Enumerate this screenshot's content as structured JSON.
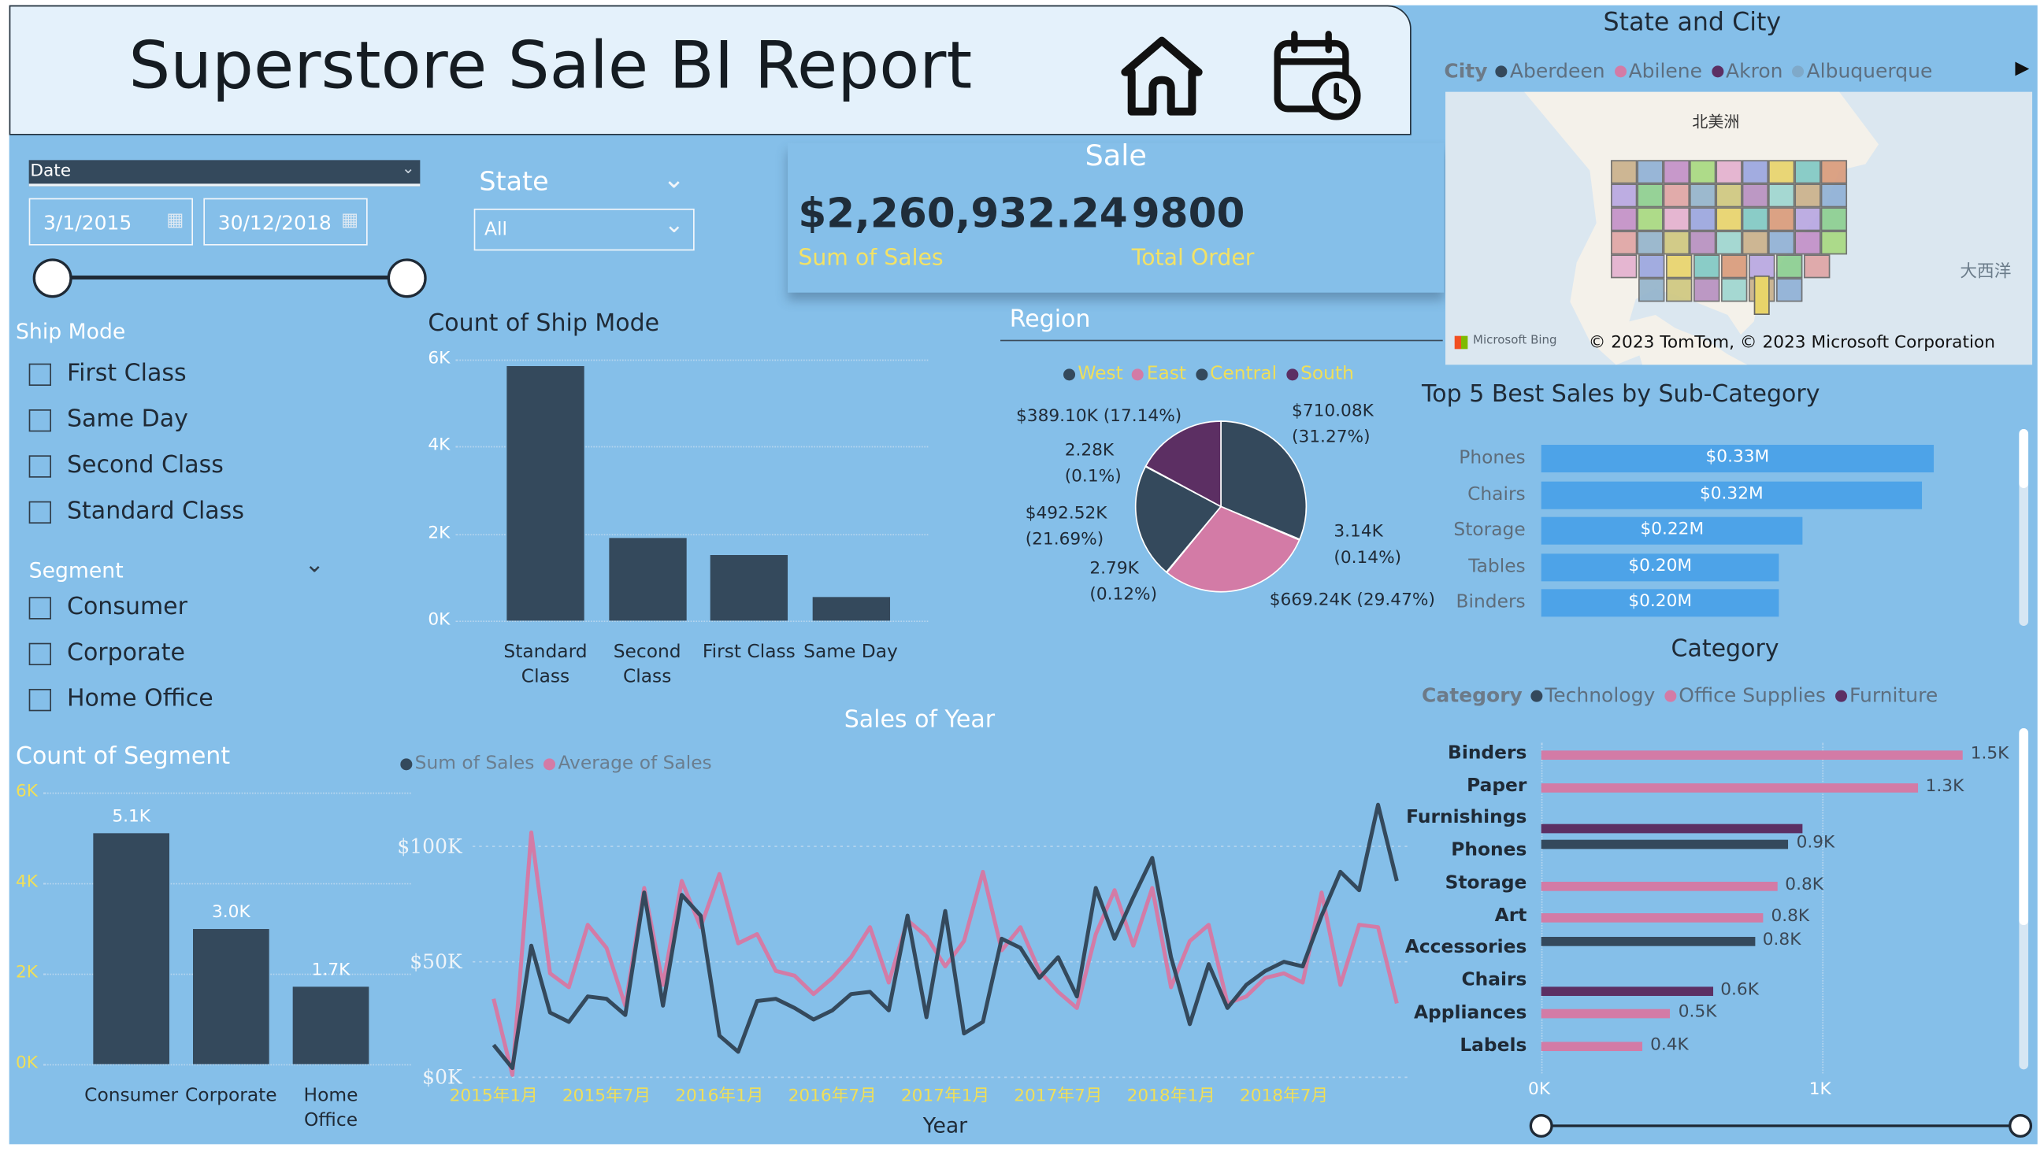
{
  "header": {
    "title": "Superstore Sale BI Report"
  },
  "filters": {
    "date_label": "Date",
    "start_date": "3/1/2015",
    "end_date": "30/12/2018",
    "state_label": "State",
    "state_value": "All",
    "ship_mode_label": "Ship Mode",
    "ship_modes": [
      "First Class",
      "Same Day",
      "Second Class",
      "Standard Class"
    ],
    "segment_label": "Segment",
    "segments": [
      "Consumer",
      "Corporate",
      "Home Office"
    ]
  },
  "kpi": {
    "title": "Sale",
    "sales_value": "$2,260,932.24",
    "sales_label": "Sum of Sales",
    "orders_value": "9800",
    "orders_label": "Total Order"
  },
  "map": {
    "title": "State and City",
    "legend_label": "City",
    "cities": [
      "Aberdeen",
      "Abilene",
      "Akron",
      "Albuquerque"
    ],
    "label_na": "北美洲",
    "label_atlantic": "大西洋",
    "bing_label": "Microsoft Bing",
    "copyright": "© 2023 TomTom, © 2023 Microsoft Corporation"
  },
  "colors": {
    "dark": "#34495c",
    "pink": "#d37ba6",
    "purple": "#5c2f63",
    "blue_bar": "#4da3e8",
    "yellow": "#f0df59"
  },
  "chart_data": [
    {
      "id": "ship_mode",
      "type": "bar",
      "title": "Count of Ship Mode",
      "categories": [
        "Standard Class",
        "Second Class",
        "First Class",
        "Same Day"
      ],
      "category_lines": [
        [
          "Standard",
          "Class"
        ],
        [
          "Second",
          "Class"
        ],
        [
          "First Class"
        ],
        [
          "Same Day"
        ]
      ],
      "values": [
        5860,
        1910,
        1500,
        540
      ],
      "yticks": [
        "6K",
        "4K",
        "2K",
        "0K"
      ],
      "ylim": [
        0,
        6000
      ]
    },
    {
      "id": "segment",
      "type": "bar",
      "title": "Count of Segment",
      "categories": [
        "Consumer",
        "Corporate",
        "Home Office"
      ],
      "category_lines": [
        [
          "Consumer"
        ],
        [
          "Corporate"
        ],
        [
          "Home",
          "Office"
        ]
      ],
      "values": [
        5100,
        3000,
        1700
      ],
      "data_labels": [
        "5.1K",
        "3.0K",
        "1.7K"
      ],
      "yticks": [
        "6K",
        "4K",
        "2K",
        "0K"
      ],
      "ylim": [
        0,
        6000
      ]
    },
    {
      "id": "region",
      "type": "pie",
      "title": "Region",
      "legend": [
        "West",
        "East",
        "Central",
        "South"
      ],
      "slices": [
        {
          "label": "$710.08K",
          "pct": "(31.27%)",
          "value": 710.08
        },
        {
          "label": "3.14K",
          "pct": "(0.14%)",
          "value": 3.14
        },
        {
          "label": "$669.24K",
          "pct": "(29.47%)",
          "value": 669.24
        },
        {
          "label": "2.79K",
          "pct": "(0.12%)",
          "value": 2.79
        },
        {
          "label": "$492.52K",
          "pct": "(21.69%)",
          "value": 492.52
        },
        {
          "label": "2.28K",
          "pct": "(0.1%)",
          "value": 2.28
        },
        {
          "label": "$389.10K",
          "pct": "(17.14%)",
          "value": 389.1
        }
      ]
    },
    {
      "id": "top5",
      "type": "bar",
      "title": "Top 5 Best Sales by Sub-Category",
      "categories": [
        "Phones",
        "Chairs",
        "Storage",
        "Tables",
        "Binders"
      ],
      "values": [
        0.33,
        0.32,
        0.22,
        0.2,
        0.2
      ],
      "data_labels": [
        "$0.33M",
        "$0.32M",
        "$0.22M",
        "$0.20M",
        "$0.20M"
      ]
    },
    {
      "id": "category",
      "type": "bar",
      "title": "Category",
      "legend_label": "Category",
      "legend": [
        "Technology",
        "Office Supplies",
        "Furniture"
      ],
      "categories": [
        "Binders",
        "Paper",
        "Furnishings",
        "Phones",
        "Storage",
        "Art",
        "Accessories",
        "Chairs",
        "Appliances",
        "Labels"
      ],
      "values": [
        1500,
        1340,
        930,
        880,
        840,
        790,
        760,
        610,
        460,
        360
      ],
      "data_labels": [
        "1.5K",
        "1.3K",
        "",
        "0.9K",
        "0.8K",
        "0.8K",
        "0.8K",
        "0.6K",
        "0.5K",
        "0.4K"
      ],
      "series": [
        "Office Supplies",
        "Office Supplies",
        "Furniture",
        "Technology",
        "Office Supplies",
        "Office Supplies",
        "Technology",
        "Furniture",
        "Office Supplies",
        "Office Supplies"
      ],
      "xticks": [
        "0K",
        "1K"
      ],
      "xlim": [
        0,
        1500
      ]
    },
    {
      "id": "sales_year",
      "type": "line",
      "title": "Sales of Year",
      "xlabel": "Year",
      "legend": [
        "Sum of Sales",
        "Average of Sales"
      ],
      "yticks": [
        "$100K",
        "$50K",
        "$0K"
      ],
      "ylim": [
        0,
        118000
      ],
      "xticks": [
        "2015年1月",
        "2015年7月",
        "2016年1月",
        "2016年7月",
        "2017年1月",
        "2017年7月",
        "2018年1月",
        "2018年7月"
      ],
      "series": [
        {
          "name": "Sum of Sales",
          "values": [
            14000,
            4000,
            57000,
            28000,
            24000,
            35000,
            34000,
            27000,
            80000,
            31000,
            79000,
            70000,
            18000,
            11000,
            33000,
            34000,
            30000,
            25000,
            29000,
            36000,
            37000,
            29000,
            70000,
            26000,
            72000,
            19000,
            24000,
            60000,
            56000,
            43000,
            52000,
            35000,
            82000,
            60000,
            78000,
            95000,
            52000,
            23000,
            49000,
            30000,
            40000,
            46000,
            50000,
            48000,
            70000,
            89000,
            81000,
            118000,
            85000
          ]
        },
        {
          "name": "Average of Sales",
          "values": [
            34000,
            1000,
            106000,
            45000,
            39000,
            66000,
            56000,
            31000,
            82000,
            40000,
            85000,
            65000,
            88000,
            58000,
            62000,
            46000,
            44000,
            36000,
            43000,
            52000,
            65000,
            41000,
            68000,
            61000,
            48000,
            59000,
            89000,
            55000,
            65000,
            46000,
            37000,
            30000,
            62000,
            81000,
            57000,
            82000,
            39000,
            59000,
            66000,
            32000,
            35000,
            43000,
            45000,
            41000,
            80000,
            40000,
            66000,
            65000,
            32000
          ]
        }
      ]
    }
  ]
}
